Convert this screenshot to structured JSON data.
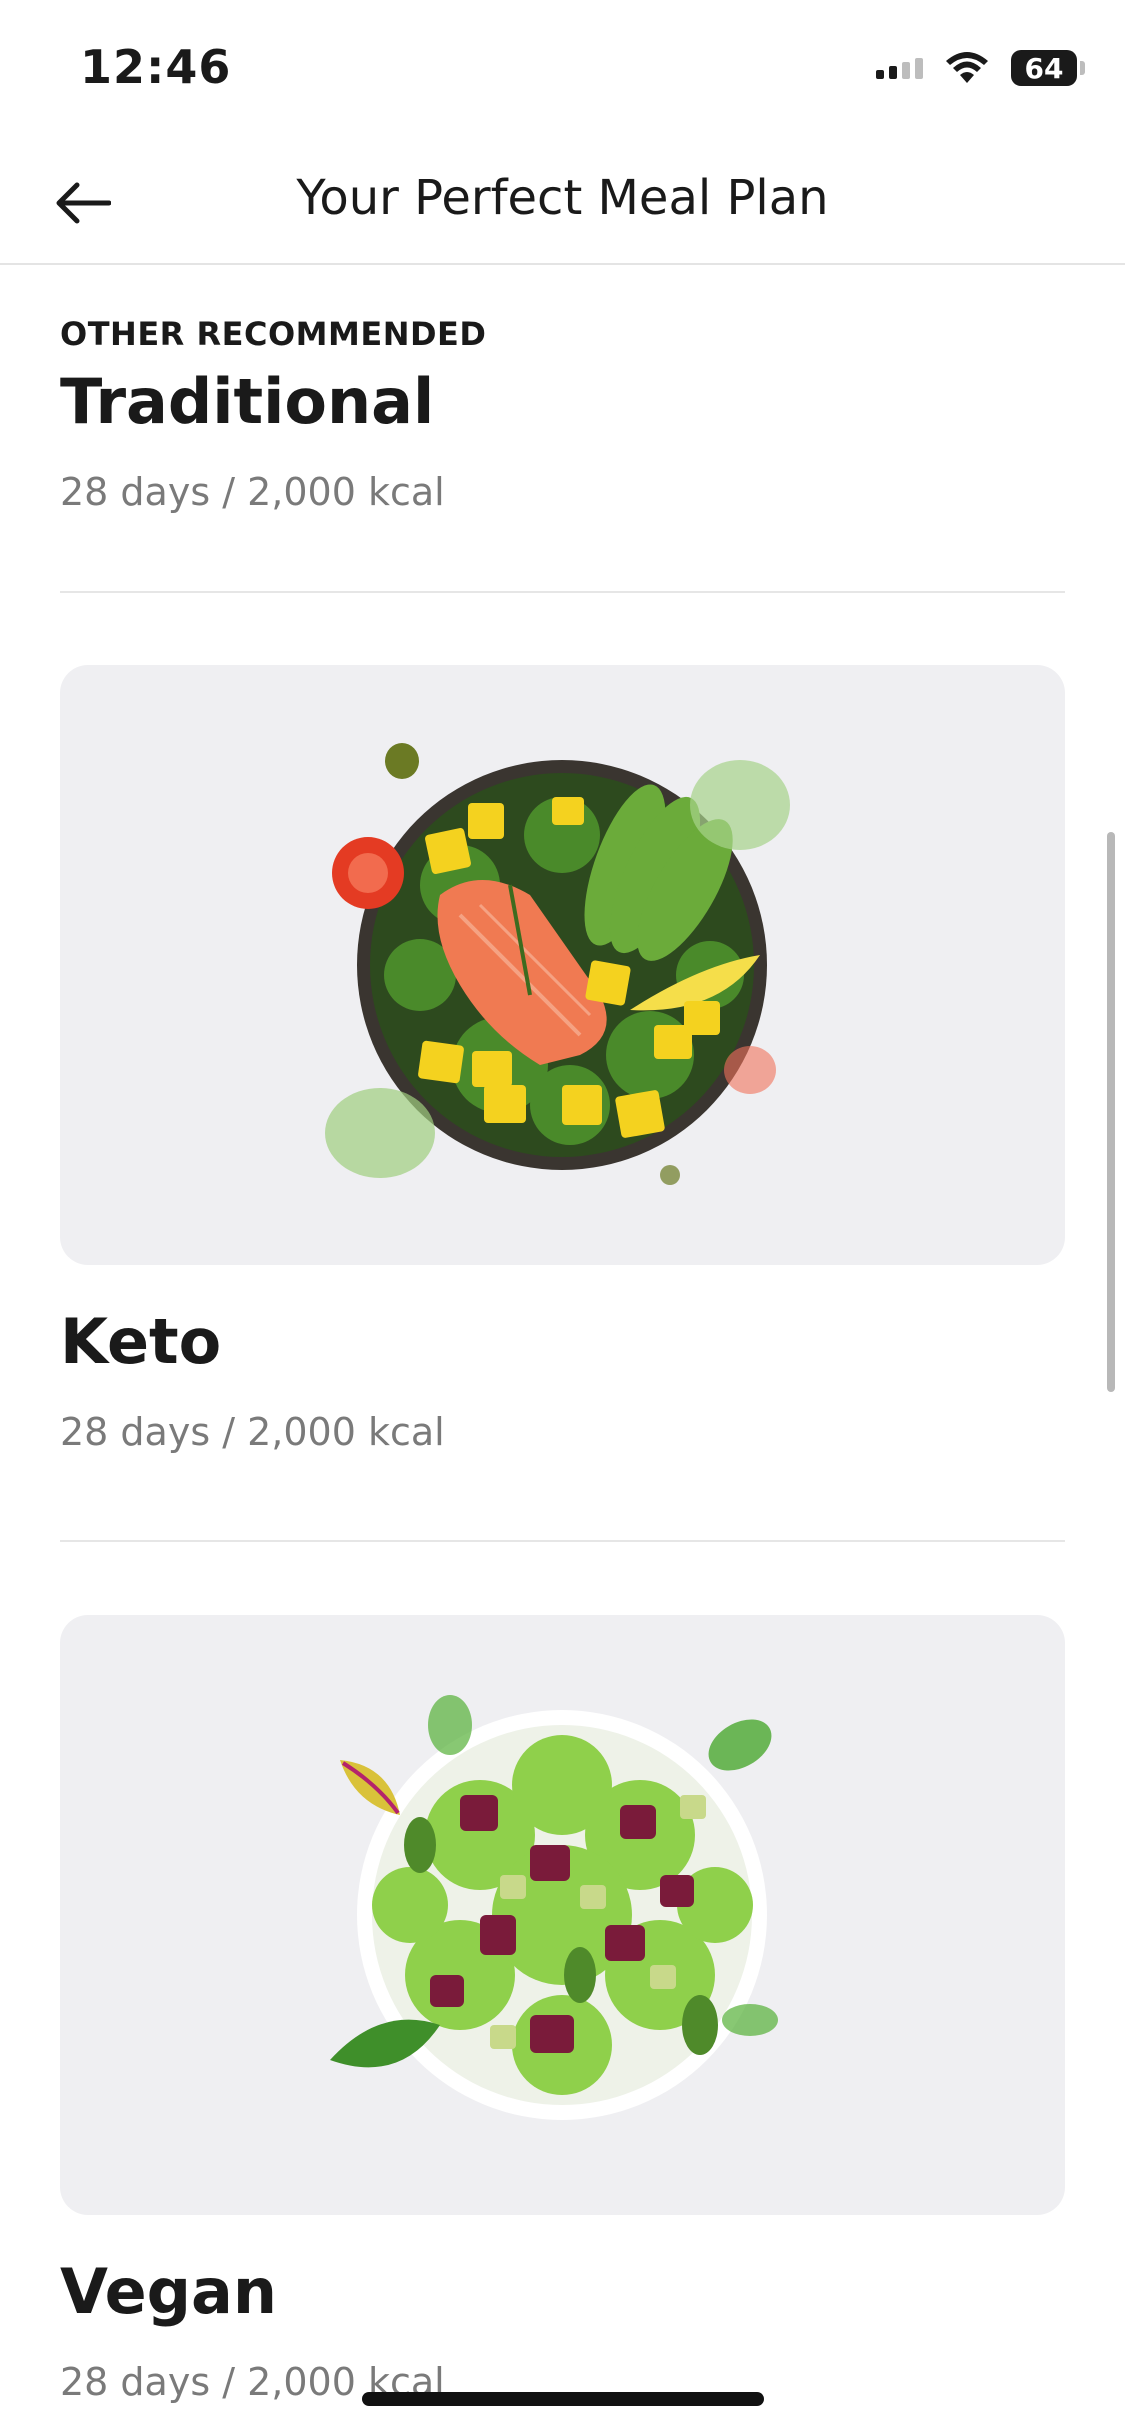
{
  "status_bar": {
    "time": "12:46",
    "battery": "64",
    "icons": [
      "signal-icon",
      "wifi-icon",
      "battery-icon"
    ]
  },
  "header": {
    "title": "Your Perfect Meal Plan",
    "back_icon": "back-arrow-icon"
  },
  "featured": {
    "eyebrow": "OTHER RECOMMENDED",
    "name": "Traditional",
    "subtitle": "28 days / 2,000 kcal"
  },
  "plans": [
    {
      "name": "Keto",
      "subtitle": "28 days / 2,000 kcal",
      "image": "salmon-avocado-bowl"
    },
    {
      "name": "Vegan",
      "subtitle": "28 days / 2,000 kcal",
      "image": "green-salad-bowl"
    }
  ],
  "colors": {
    "card_bg": "#efeff2",
    "text_primary": "#1a1a1a",
    "text_secondary": "#7a7a7a",
    "divider": "#e6e6e6"
  }
}
